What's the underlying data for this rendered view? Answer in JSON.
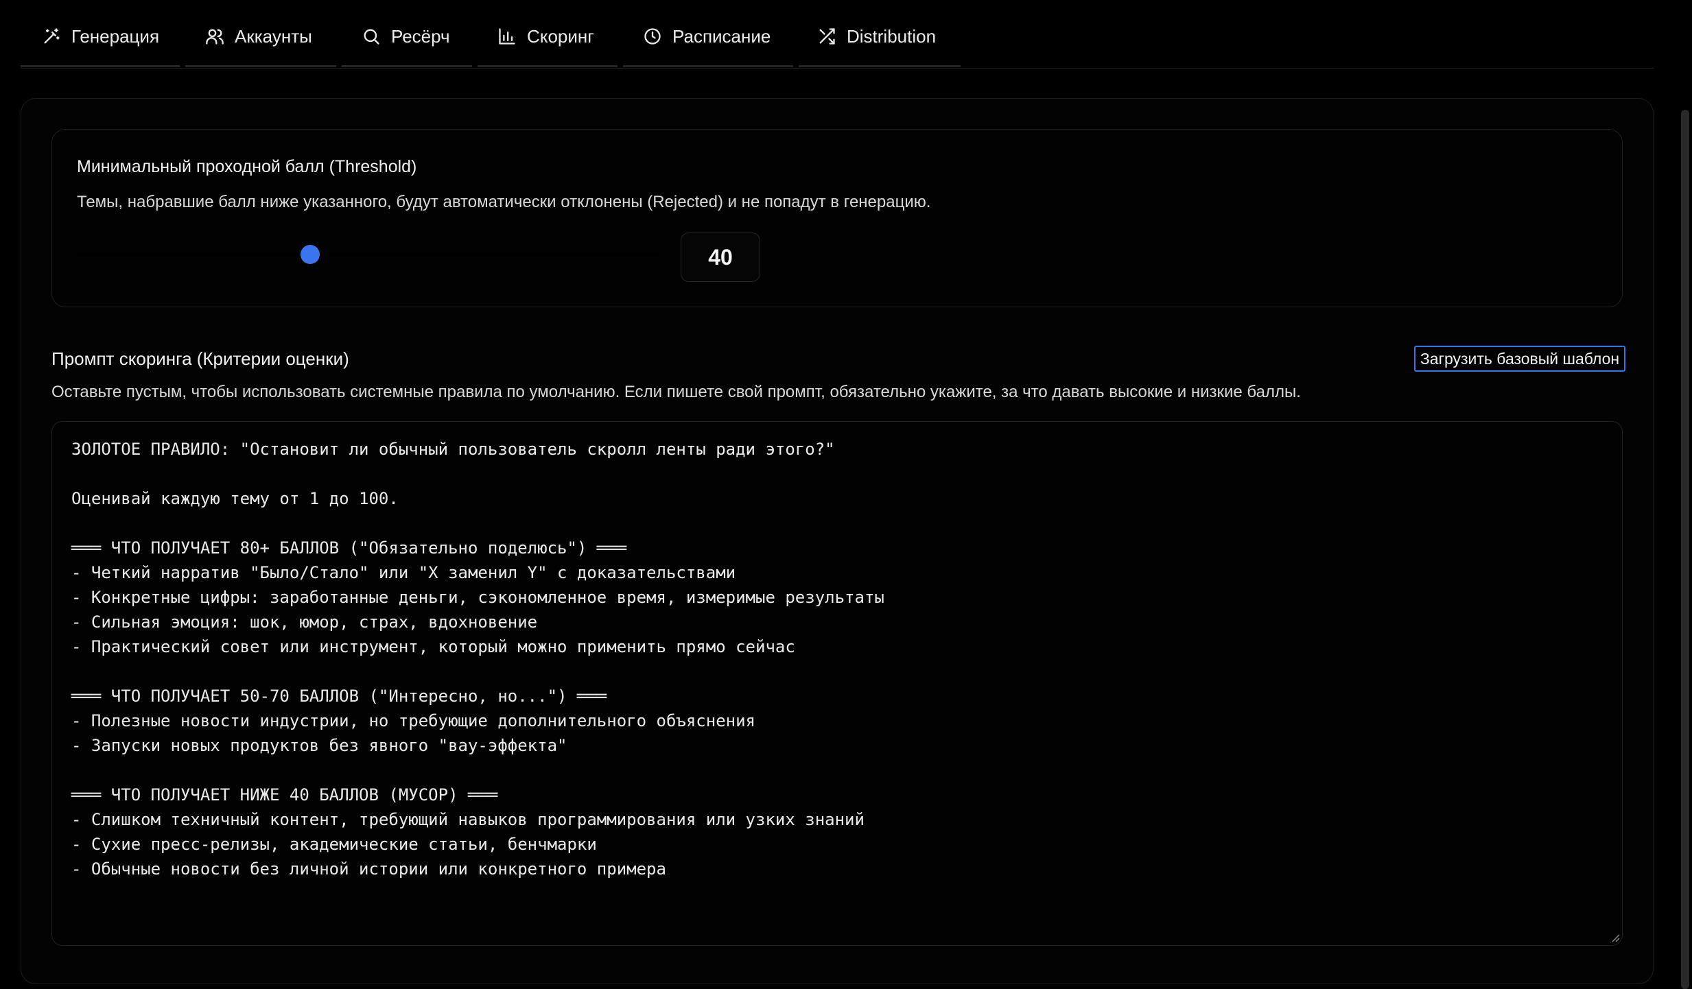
{
  "tabs": [
    {
      "label": "Генерация",
      "icon": "magic-wand-icon"
    },
    {
      "label": "Аккаунты",
      "icon": "users-icon"
    },
    {
      "label": "Ресёрч",
      "icon": "search-icon"
    },
    {
      "label": "Скоринг",
      "icon": "bar-chart-icon"
    },
    {
      "label": "Расписание",
      "icon": "clock-icon"
    },
    {
      "label": "Distribution",
      "icon": "shuffle-icon"
    }
  ],
  "threshold": {
    "title": "Минимальный проходной балл (Threshold)",
    "description": "Темы, набравшие балл ниже указанного, будут автоматически отклонены (Rejected) и не попадут в генерацию.",
    "value": "40",
    "min": 0,
    "max": 100,
    "accent_color": "#3b74ef"
  },
  "prompt": {
    "title": "Промпт скоринга (Критерии оценки)",
    "load_template_label": "Загрузить базовый шаблон",
    "description": "Оставьте пустым, чтобы использовать системные правила по умолчанию. Если пишете свой промпт, обязательно укажите, за что давать высокие и низкие баллы.",
    "text": "ЗОЛОТОЕ ПРАВИЛО: \"Остановит ли обычный пользователь скролл ленты ради этого?\"\n\nОценивай каждую тему от 1 до 100.\n\n═══ ЧТО ПОЛУЧАЕТ 80+ БАЛЛОВ (\"Обязательно поделюсь\") ═══\n- Четкий нарратив \"Было/Стало\" или \"X заменил Y\" с доказательствами\n- Конкретные цифры: заработанные деньги, сэкономленное время, измеримые результаты\n- Сильная эмоция: шок, юмор, страх, вдохновение\n- Практический совет или инструмент, который можно применить прямо сейчас\n\n═══ ЧТО ПОЛУЧАЕТ 50-70 БАЛЛОВ (\"Интересно, но...\") ═══\n- Полезные новости индустрии, но требующие дополнительного объяснения\n- Запуски новых продуктов без явного \"вау-эффекта\"\n\n═══ ЧТО ПОЛУЧАЕТ НИЖЕ 40 БАЛЛОВ (МУСОР) ═══\n- Слишком техничный контент, требующий навыков программирования или узких знаний\n- Сухие пресс-релизы, академические статьи, бенчмарки\n- Обычные новости без личной истории или конкретного примера"
  }
}
